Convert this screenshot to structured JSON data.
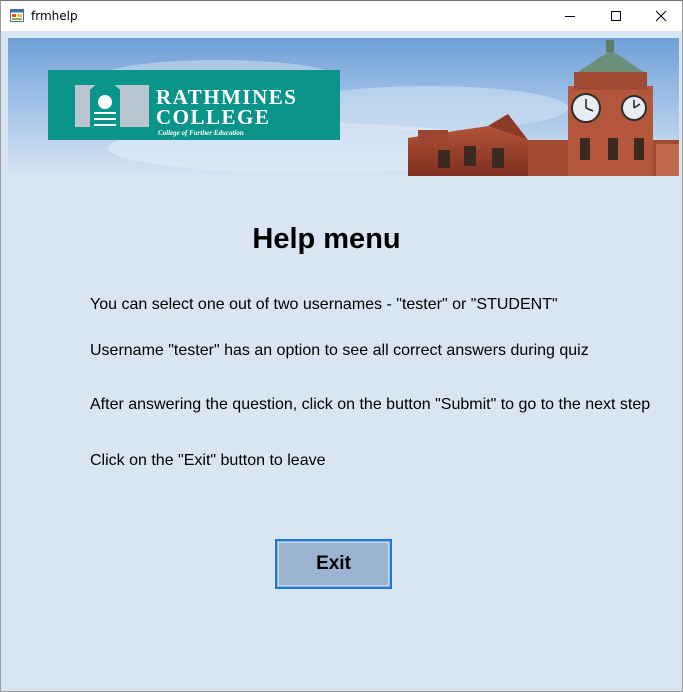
{
  "window": {
    "title": "frmhelp",
    "icons": {
      "app": "form-icon",
      "minimize": "minimize-icon",
      "maximize": "maximize-icon",
      "close": "close-icon"
    }
  },
  "banner": {
    "logo_line1": "RATHMINES",
    "logo_line2": "COLLEGE",
    "logo_tagline": "College of Further Education",
    "logo_color": "#0b9489"
  },
  "help": {
    "heading": "Help menu",
    "lines": [
      "You can select  one out of two usernames - \"tester\" or \"STUDENT\"",
      "Username \"tester\" has an option to see all correct answers during quiz",
      "After answering the question, click on the button \"Submit\" to go to the next step",
      "Click on the \"Exit\" button to leave"
    ]
  },
  "exit_button": {
    "label": "Exit"
  },
  "colors": {
    "client_bg": "#d9e5f2",
    "button_bg": "#9ab3d0",
    "button_border": "#1e78d6"
  }
}
